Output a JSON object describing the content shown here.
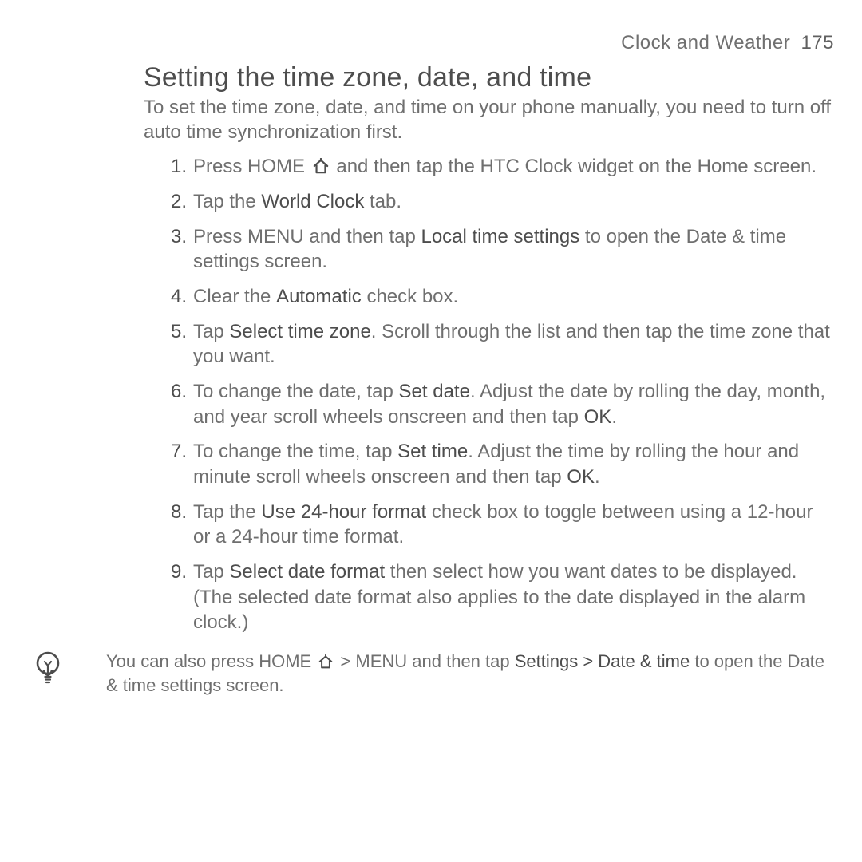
{
  "header": {
    "section": "Clock and Weather",
    "page": "175"
  },
  "title": "Setting the time zone, date, and time",
  "intro": "To set the time zone, date, and time on your phone manually, you need to turn off auto time synchronization first.",
  "steps": {
    "s1a": "Press HOME ",
    "s1b": " and then tap the HTC Clock widget on the Home screen.",
    "s2a": "Tap the ",
    "s2b": "World Clock",
    "s2c": " tab.",
    "s3a": "Press MENU and then tap ",
    "s3b": "Local time settings",
    "s3c": " to open the Date & time settings screen.",
    "s4a": "Clear the ",
    "s4b": "Automatic",
    "s4c": " check box.",
    "s5a": "Tap ",
    "s5b": "Select time zone",
    "s5c": ". Scroll through the list and then tap the time zone that you want.",
    "s6a": "To change the date, tap ",
    "s6b": "Set date",
    "s6c": ". Adjust the date by rolling the day, month, and year scroll wheels onscreen and then tap ",
    "s6d": "OK",
    "s6e": ".",
    "s7a": "To change the time, tap ",
    "s7b": "Set time",
    "s7c": ". Adjust the time by rolling the hour and minute scroll wheels onscreen and then tap ",
    "s7d": "OK",
    "s7e": ".",
    "s8a": "Tap the ",
    "s8b": "Use 24-hour format",
    "s8c": " check box to toggle between using a 12-hour or a 24-hour time format.",
    "s9a": "Tap ",
    "s9b": "Select date format",
    "s9c": " then select how you want dates to be displayed. (The selected date format also applies to the date displayed in the alarm clock.)"
  },
  "tip": {
    "a": "You can also press HOME ",
    "b": " > MENU and then tap ",
    "c": "Settings > Date & time",
    "d": " to open the Date & time settings screen."
  },
  "nums": {
    "n1": "1.",
    "n2": "2.",
    "n3": "3.",
    "n4": "4.",
    "n5": "5.",
    "n6": "6.",
    "n7": "7.",
    "n8": "8.",
    "n9": "9."
  }
}
